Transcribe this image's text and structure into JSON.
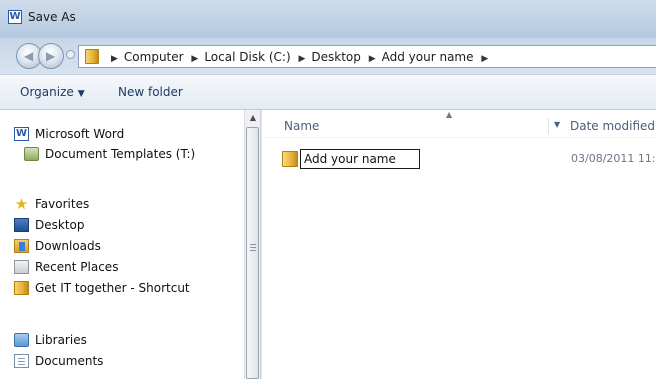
{
  "window": {
    "title": "Save As",
    "app_icon_letter": "W"
  },
  "address_bar": {
    "breadcrumbs": [
      "Computer",
      "Local Disk (C:)",
      "Desktop",
      "Add your name"
    ]
  },
  "toolbar": {
    "organize_label": "Organize",
    "new_folder_label": "New folder"
  },
  "nav_pane": {
    "word_icon_letter": "W",
    "items": [
      {
        "label": "Microsoft Word",
        "icon": "word-icon"
      },
      {
        "label": "Document Templates (T:)",
        "icon": "network-drive-icon"
      },
      {
        "label": "Favorites",
        "icon": "star-icon"
      },
      {
        "label": "Desktop",
        "icon": "desktop-icon"
      },
      {
        "label": "Downloads",
        "icon": "downloads-icon"
      },
      {
        "label": "Recent Places",
        "icon": "recent-places-icon"
      },
      {
        "label": "Get IT together - Shortcut",
        "icon": "folder-shortcut-icon"
      },
      {
        "label": "Libraries",
        "icon": "libraries-icon"
      },
      {
        "label": "Documents",
        "icon": "documents-icon"
      }
    ]
  },
  "file_list": {
    "columns": {
      "name": "Name",
      "date_modified": "Date modified"
    },
    "rows": [
      {
        "name": "Add your name",
        "date_modified": "03/08/2011 11:",
        "editing": true
      }
    ]
  },
  "colors": {
    "title_bar": "#bfd1e4",
    "toolbar": "#e3ebf4",
    "header_text": "#4c607a",
    "folder": "#e8b636"
  }
}
